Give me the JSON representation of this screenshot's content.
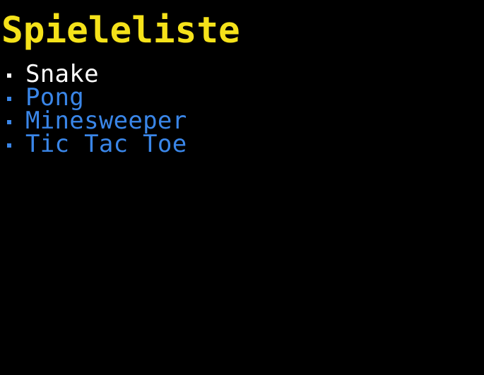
{
  "title": "Spieleliste",
  "colors": {
    "background": "#000000",
    "title": "#f5e21a",
    "selected": "#ffffff",
    "item": "#3a86e8"
  },
  "games": [
    {
      "label": "Snake",
      "selected": true
    },
    {
      "label": "Pong",
      "selected": false
    },
    {
      "label": "Minesweeper",
      "selected": false
    },
    {
      "label": "Tic Tac Toe",
      "selected": false
    }
  ]
}
